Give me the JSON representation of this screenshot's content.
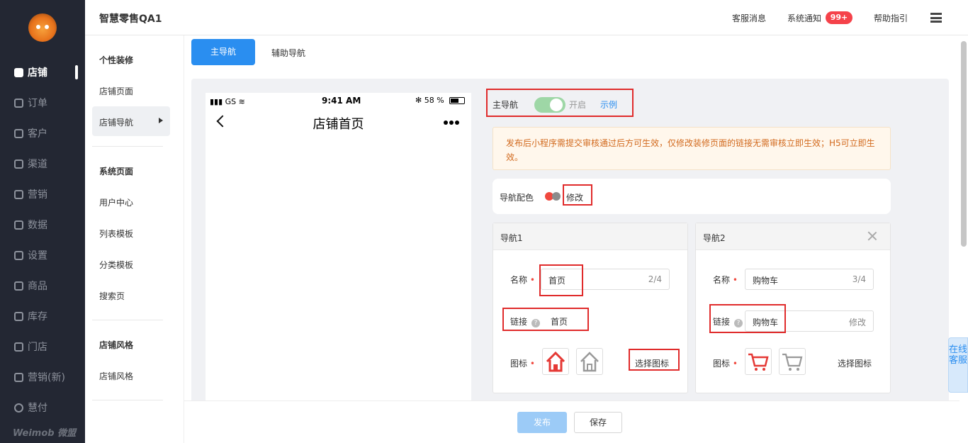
{
  "sidebar": {
    "items": [
      {
        "label": "店铺",
        "icon": "store-icon"
      },
      {
        "label": "订单",
        "icon": "order-icon"
      },
      {
        "label": "客户",
        "icon": "customer-icon"
      },
      {
        "label": "渠道",
        "icon": "channel-icon"
      },
      {
        "label": "营销",
        "icon": "marketing-icon"
      },
      {
        "label": "数据",
        "icon": "data-icon"
      },
      {
        "label": "设置",
        "icon": "settings-icon"
      },
      {
        "label": "商品",
        "icon": "goods-icon"
      },
      {
        "label": "库存",
        "icon": "inventory-icon"
      },
      {
        "label": "门店",
        "icon": "shop-icon"
      },
      {
        "label": "营销(新)",
        "icon": "marketing-new-icon"
      },
      {
        "label": "慧付",
        "icon": "pay-icon"
      }
    ],
    "logo": "Weimob 微盟"
  },
  "header": {
    "shop_name": "智慧零售QA1",
    "service_msg": "客服消息",
    "system_notice": "系统通知",
    "notice_badge": "99+",
    "help": "帮助指引"
  },
  "subnav": {
    "groups": [
      {
        "title": "个性装修",
        "items": [
          "店铺页面",
          "店铺导航"
        ]
      },
      {
        "title": "系统页面",
        "items": [
          "用户中心",
          "列表模板",
          "分类模板",
          "搜索页"
        ]
      },
      {
        "title": "店铺风格",
        "items": [
          "店铺风格"
        ]
      }
    ]
  },
  "tabs": {
    "main": "主导航",
    "aux": "辅助导航"
  },
  "phone": {
    "signal": "GS",
    "time": "9:41 AM",
    "battery": "58 %",
    "title": "店铺首页"
  },
  "settings": {
    "main_nav_label": "主导航",
    "toggle_text": "开启",
    "example_link": "示例",
    "notice": "发布后小程序需提交审核通过后方可生效，仅修改装修页面的链接无需审核立即生效；H5可立即生效。",
    "color_label": "导航配色",
    "color_edit": "修改"
  },
  "nav_cards": [
    {
      "title": "导航1",
      "name_label": "名称",
      "name_value": "首页",
      "name_count": "2/4",
      "link_label": "链接",
      "link_value": "首页",
      "link_edit": "",
      "icon_label": "图标",
      "choose_icon": "选择图标"
    },
    {
      "title": "导航2",
      "name_label": "名称",
      "name_value": "购物车",
      "name_count": "3/4",
      "link_label": "链接",
      "link_value": "购物车",
      "link_edit": "修改",
      "icon_label": "图标",
      "choose_icon": "选择图标"
    }
  ],
  "footer": {
    "publish": "发布",
    "save": "保存"
  },
  "online_service": "在线客服",
  "colors": {
    "sidebar": "#232733",
    "primary": "#2a8ef0",
    "danger": "#f0483e",
    "highlight": "#e02b2b"
  }
}
